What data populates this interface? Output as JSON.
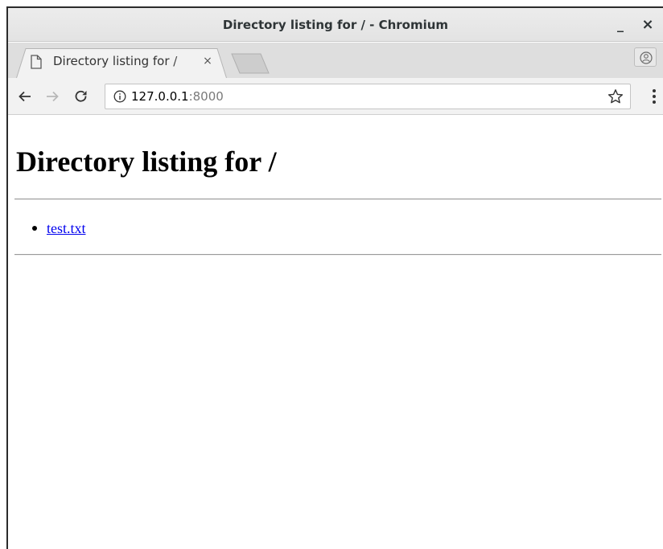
{
  "window": {
    "title": "Directory listing for / - Chromium",
    "minimize_glyph": "_",
    "close_glyph": "×"
  },
  "tabs": [
    {
      "title": "Directory listing for /",
      "close_glyph": "×",
      "icon": "document-icon",
      "active": true
    }
  ],
  "toolbar": {
    "back_icon": "arrow-left-icon",
    "forward_icon": "arrow-right-icon",
    "reload_icon": "reload-icon",
    "menu_icon": "kebab-menu-icon",
    "profile_icon": "person-icon"
  },
  "omnibox": {
    "info_icon": "info-icon",
    "host": "127.0.0.1",
    "port": ":8000",
    "bookmark_icon": "star-icon"
  },
  "page": {
    "heading": "Directory listing for /",
    "files": [
      {
        "name": "test.txt"
      }
    ]
  },
  "colors": {
    "link": "#0000ee",
    "titlebar": "#e6e6e6",
    "toolbar": "#f2f2f2",
    "tabstrip": "#dedede"
  }
}
